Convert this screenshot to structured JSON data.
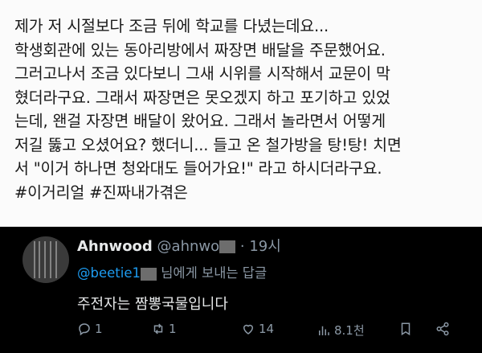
{
  "post": {
    "text": "제가 저 시절보다 조금 뒤에 학교를 다녔는데요...\n학생회관에 있는 동아리방에서 짜장면 배달을 주문했어요.\n그러고나서 조금 있다보니 그새 시위를 시작해서 교문이 막\n혔더라구요. 그래서 짜장면은 못오겠지 하고 포기하고 있었\n는데, 왠걸 자장면 배달이 왔어요. 그래서 놀라면서 어떻게\n저길 뚫고 오셨어요? 했더니... 들고 온 철가방을 탕!탕! 치면\n서 \"이거 하나면 청와대도 들어가요!\" 라고 하시더라구요.\n#이거리얼 #진짜내가겪은"
  },
  "reply": {
    "name": "Ahnwood",
    "handle": "@ahnwo",
    "time": "· 19시",
    "mention": "@beetie1",
    "replying_suffix": "님에게 보내는 답글",
    "body": "주전자는 짬뽕국물입니다",
    "actions": {
      "replies": "1",
      "retweets": "1",
      "likes": "14",
      "views": "8.1천"
    }
  }
}
